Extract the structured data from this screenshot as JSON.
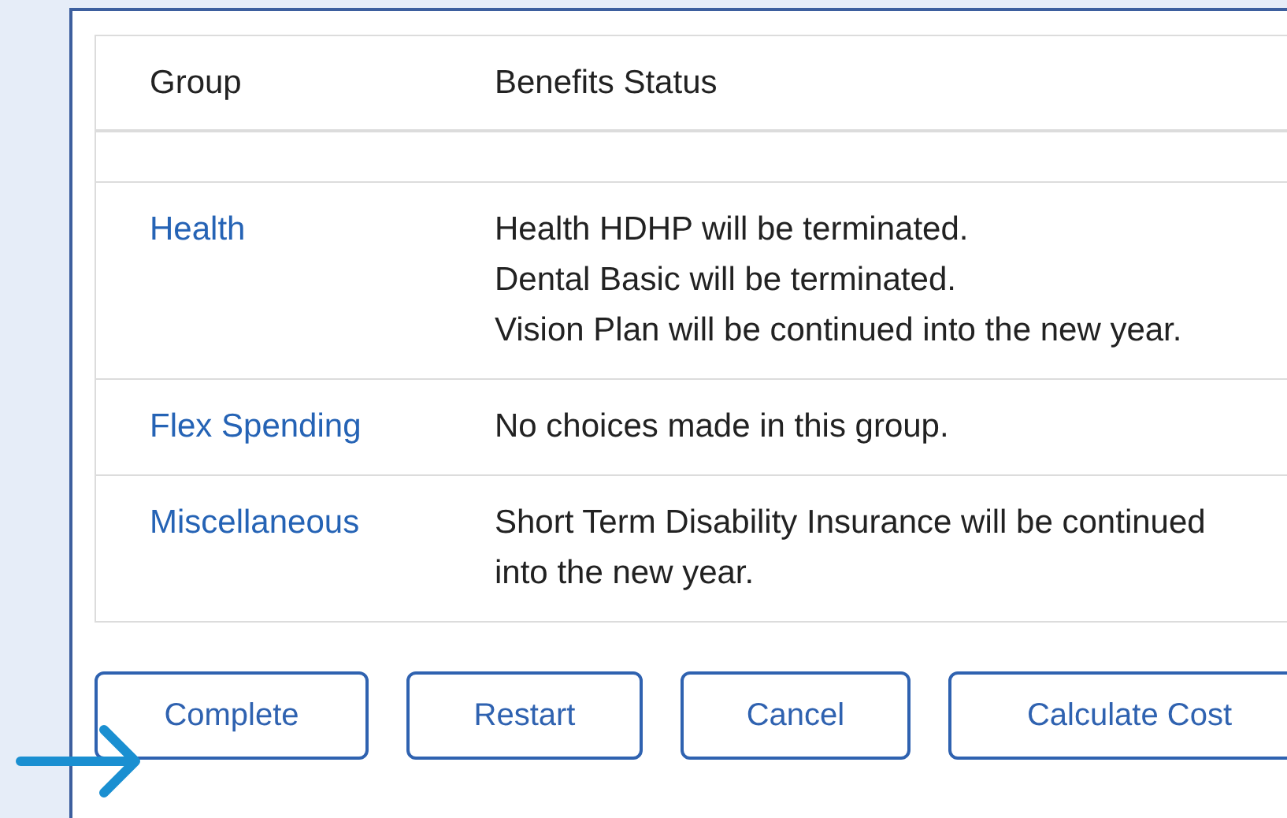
{
  "table": {
    "columns": [
      "Group",
      "Benefits Status"
    ],
    "rows": [
      {
        "group": "Health",
        "status": [
          "Health HDHP will be terminated.",
          "Dental Basic will be terminated.",
          "Vision Plan will be continued into the new year."
        ]
      },
      {
        "group": "Flex Spending",
        "status": [
          "No choices made in this group."
        ]
      },
      {
        "group": "Miscellaneous",
        "status": [
          "Short Term Disability Insurance will be continued into the new year."
        ]
      }
    ]
  },
  "buttons": [
    "Complete",
    "Restart",
    "Cancel",
    "Calculate Cost"
  ]
}
